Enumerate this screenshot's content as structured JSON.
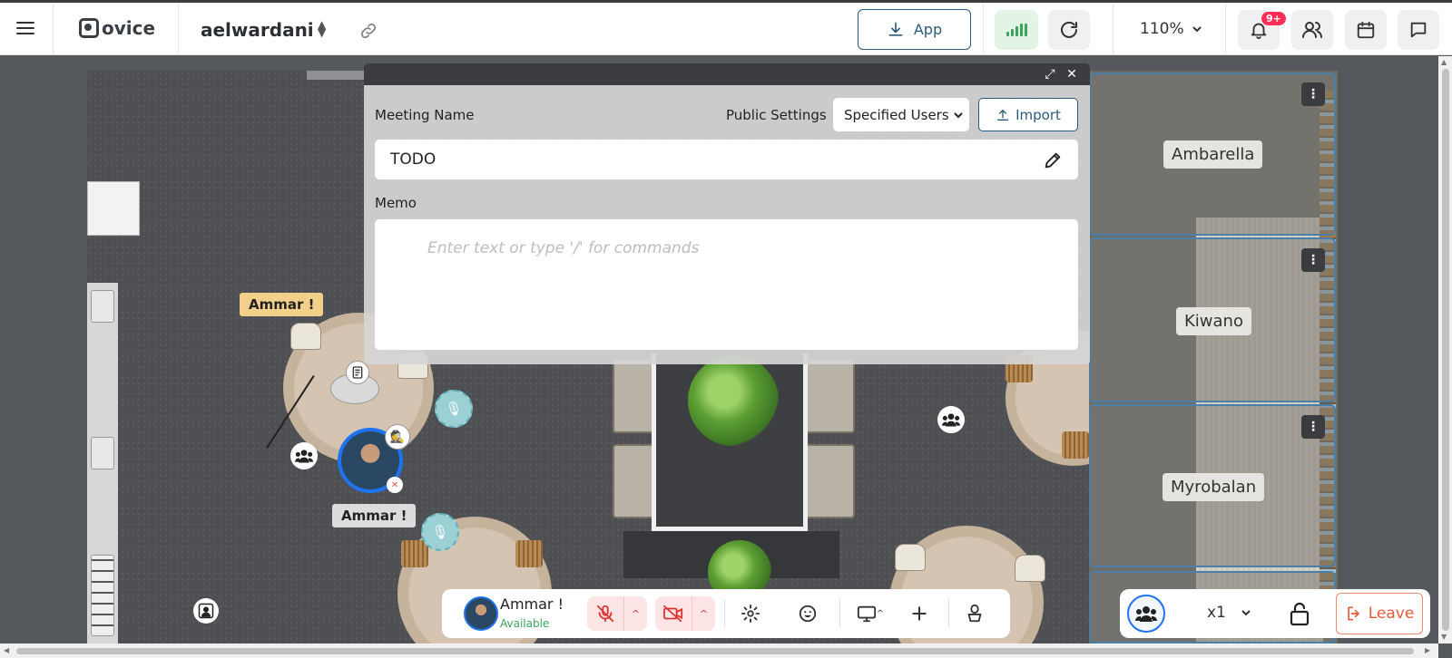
{
  "header": {
    "logo_text": "ovice",
    "workspace": "aelwardani",
    "app_button": "App",
    "zoom": "110%",
    "notification_badge": "9+"
  },
  "map": {
    "avatar_name_top": "Ammar !",
    "avatar_name_bottom": "Ammar !",
    "zones": [
      "Ambarella",
      "Kiwano",
      "Myrobalan"
    ]
  },
  "meeting_panel": {
    "meeting_name_label": "Meeting Name",
    "public_settings_label": "Public Settings",
    "public_settings_value": "Specified Users",
    "import_label": "Import",
    "meeting_name_value": "TODO",
    "memo_label": "Memo",
    "memo_placeholder": "Enter text or type '/' for commands"
  },
  "bottom_bar": {
    "user_name": "Ammar !",
    "user_status": "Available",
    "status_color": "#3aa55a"
  },
  "right_bar": {
    "speed": "x1",
    "leave_label": "Leave",
    "leave_color": "#e85a3a"
  },
  "colors": {
    "accent": "#1e74f0",
    "brand_dark": "#2a5b7c",
    "badge": "#ff2d55"
  }
}
